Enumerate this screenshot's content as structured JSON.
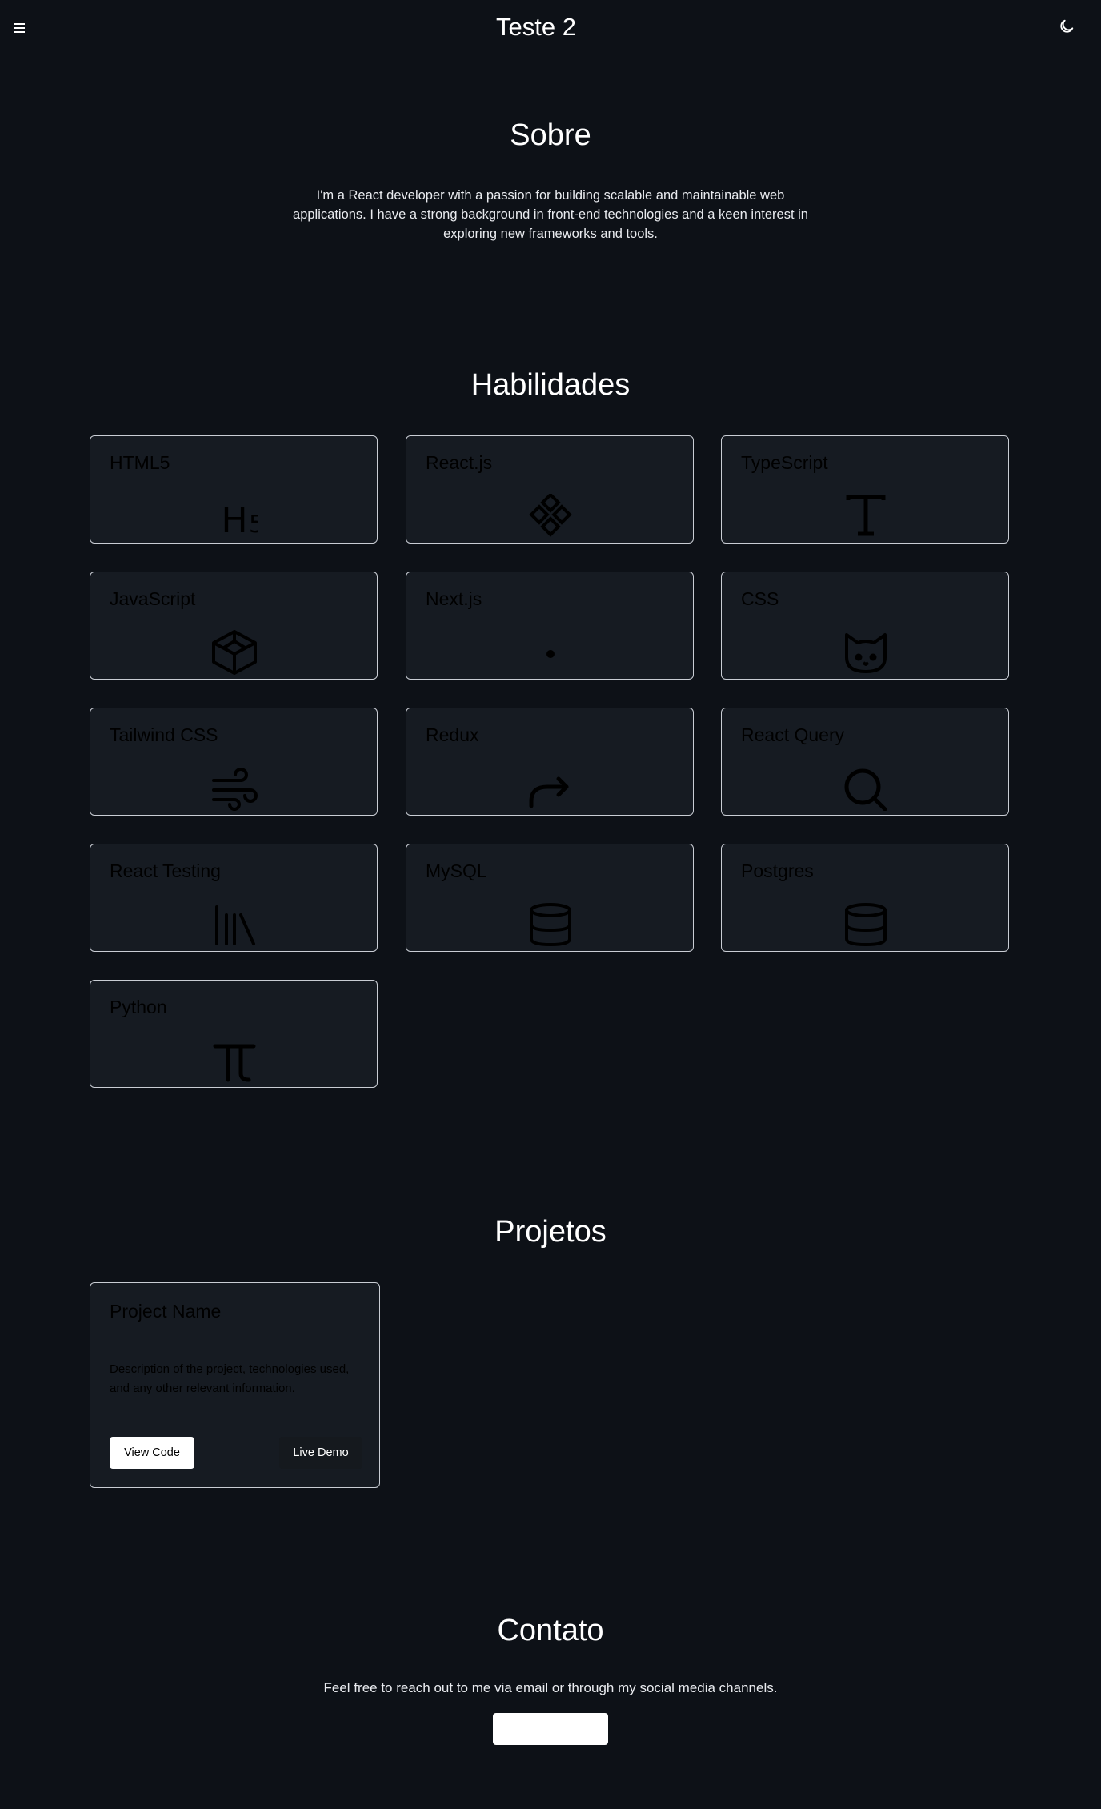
{
  "header": {
    "menu_icon": "hamburger-icon",
    "title": "Teste 2",
    "theme_icon": "moon-icon"
  },
  "about": {
    "title": "Sobre",
    "text": "I'm a React developer with a passion for building scalable and maintainable web applications. I have a strong background in front-end technologies and a keen interest in exploring new frameworks and tools."
  },
  "skills": {
    "title": "Habilidades",
    "items": [
      {
        "label": "HTML5",
        "icon": "html5-icon"
      },
      {
        "label": "React.js",
        "icon": "react-icon"
      },
      {
        "label": "TypeScript",
        "icon": "typescript-icon"
      },
      {
        "label": "JavaScript",
        "icon": "javascript-icon"
      },
      {
        "label": "Next.js",
        "icon": "nextjs-icon"
      },
      {
        "label": "CSS",
        "icon": "css-icon"
      },
      {
        "label": "Tailwind CSS",
        "icon": "tailwind-icon"
      },
      {
        "label": "Redux",
        "icon": "redux-icon"
      },
      {
        "label": "React Query",
        "icon": "react-query-icon"
      },
      {
        "label": "React Testing",
        "icon": "react-testing-icon"
      },
      {
        "label": "MySQL",
        "icon": "mysql-icon"
      },
      {
        "label": "Postgres",
        "icon": "postgres-icon"
      },
      {
        "label": "Python",
        "icon": "python-icon"
      }
    ]
  },
  "projects": {
    "title": "Projetos",
    "items": [
      {
        "name": "Project Name",
        "description": "Description of the project, technologies used, and any other relevant information.",
        "view_code_label": "View Code",
        "live_demo_label": "Live Demo"
      }
    ]
  },
  "contact": {
    "title": "Contato",
    "text": "Feel free to reach out to me via email or through my social media channels."
  },
  "colors": {
    "background": "#0d1117",
    "card": "#161b22",
    "card_border": "#c9cdd4"
  }
}
